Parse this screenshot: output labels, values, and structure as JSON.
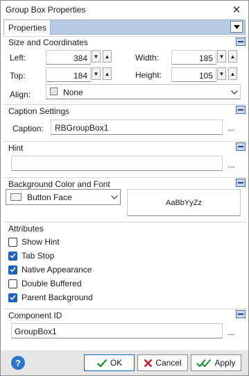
{
  "window": {
    "title": "Group Box Properties"
  },
  "tab": {
    "label": "Properties"
  },
  "sections": {
    "size": {
      "title": "Size and Coordinates",
      "left_label": "Left:",
      "left_value": "384",
      "top_label": "Top:",
      "top_value": "184",
      "width_label": "Width:",
      "width_value": "185",
      "height_label": "Height:",
      "height_value": "105",
      "align_label": "Align:",
      "align_value": "None"
    },
    "caption": {
      "title": "Caption Settings",
      "label": "Caption:",
      "value": "RBGroupBox1"
    },
    "hint": {
      "title": "Hint",
      "value": ""
    },
    "background": {
      "title": "Background Color and Font",
      "color_value": "Button Face",
      "font_preview": "AaBbYyZz"
    },
    "attributes": {
      "title": "Attributes",
      "items": [
        {
          "label": "Show Hint",
          "checked": false
        },
        {
          "label": "Tab Stop",
          "checked": true
        },
        {
          "label": "Native Appearance",
          "checked": true
        },
        {
          "label": "Double Buffered",
          "checked": false
        },
        {
          "label": "Parent Background",
          "checked": true
        }
      ]
    },
    "component": {
      "title": "Component ID",
      "value": "GroupBox1"
    }
  },
  "ellipsis": "...",
  "icons": {
    "close": "close-icon",
    "help": "help-icon",
    "collapse": "collapse-icon"
  },
  "buttons": {
    "help": "?",
    "ok": "OK",
    "cancel": "Cancel",
    "apply": "Apply"
  },
  "colors": {
    "accent": "#1e62b8",
    "tabstrip": "#b7cbe6",
    "help": "#2a77c9",
    "ok_check": "#1a8a2a",
    "cancel_x": "#c0202a"
  }
}
